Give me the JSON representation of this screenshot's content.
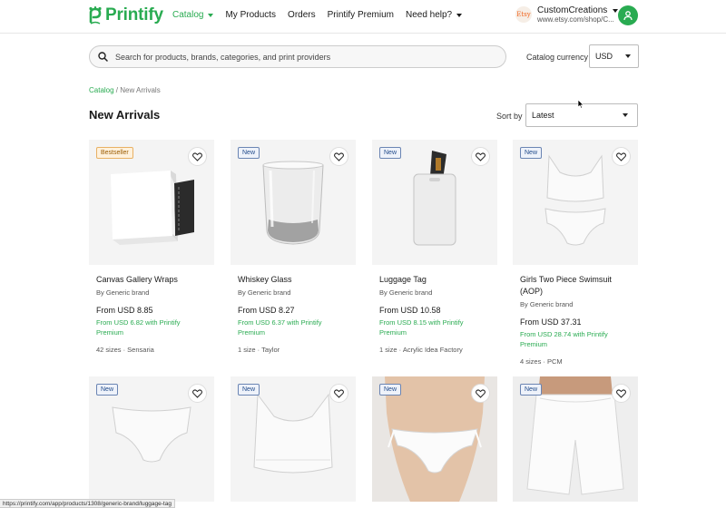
{
  "header": {
    "logo_text": "Printify",
    "nav": [
      {
        "label": "Catalog",
        "active": true,
        "dropdown": true
      },
      {
        "label": "My Products",
        "active": false,
        "dropdown": false
      },
      {
        "label": "Orders",
        "active": false,
        "dropdown": false
      },
      {
        "label": "Printify Premium",
        "active": false,
        "dropdown": false
      },
      {
        "label": "Need help?",
        "active": false,
        "dropdown": true
      }
    ],
    "account": {
      "store_badge": "Etsy",
      "store_name": "CustomCreations",
      "store_url": "www.etsy.com/shop/C..."
    }
  },
  "search": {
    "placeholder": "Search for products, brands, categories, and print providers",
    "value": ""
  },
  "currency": {
    "label": "Catalog currency",
    "selected": "USD"
  },
  "breadcrumb": {
    "root": "Catalog",
    "separator": " / ",
    "current": "New Arrivals"
  },
  "page_title": "New Arrivals",
  "sort": {
    "label": "Sort by",
    "selected": "Latest"
  },
  "products": [
    {
      "badge": "Bestseller",
      "badge_type": "best",
      "title": "Canvas Gallery Wraps",
      "brand": "By Generic brand",
      "price": "From USD 8.85",
      "premium": "From USD 6.82 with Printify Premium",
      "meta": "42 sizes · Sensaria",
      "image": "canvas-box"
    },
    {
      "badge": "New",
      "badge_type": "new",
      "title": "Whiskey Glass",
      "brand": "By Generic brand",
      "price": "From USD 8.27",
      "premium": "From USD 6.37 with Printify Premium",
      "meta": "1 size · Taylor",
      "image": "whiskey-glass"
    },
    {
      "badge": "New",
      "badge_type": "new",
      "title": "Luggage Tag",
      "brand": "By Generic brand",
      "price": "From USD 10.58",
      "premium": "From USD 8.15 with Printify Premium",
      "meta": "1 size · Acrylic Idea Factory",
      "image": "luggage-tag"
    },
    {
      "badge": "New",
      "badge_type": "new",
      "title": "Girls Two Piece Swimsuit (AOP)",
      "brand": "By Generic brand",
      "price": "From USD 37.31",
      "premium": "From USD 28.74 with Printify Premium",
      "meta": "4 sizes · PCM",
      "image": "swimsuit"
    },
    {
      "badge": "New",
      "badge_type": "new",
      "image": "briefs"
    },
    {
      "badge": "New",
      "badge_type": "new",
      "image": "sports-bra"
    },
    {
      "badge": "New",
      "badge_type": "new",
      "image": "bikini-bottom"
    },
    {
      "badge": "New",
      "badge_type": "new",
      "image": "shorts"
    }
  ],
  "status_bar": "https://printify.com/app/products/1308/generic-brand/luggage-tag",
  "colors": {
    "brand_green": "#29ab51",
    "new_badge": "#1f4a8a",
    "bestseller_badge": "#9a5b00"
  }
}
